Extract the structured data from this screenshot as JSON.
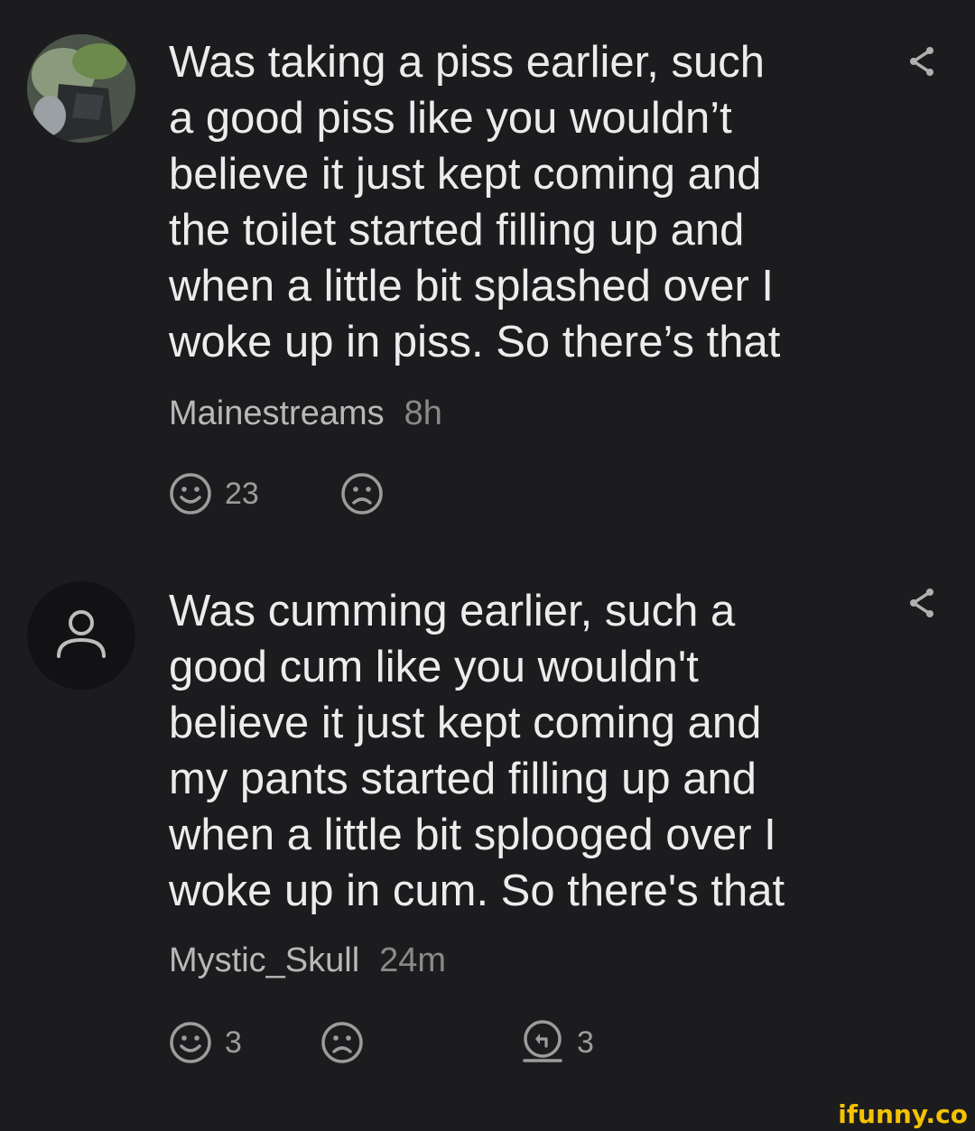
{
  "comments": [
    {
      "text": "Was taking a piss earlier, such\na good piss like you wouldn’t\nbelieve it just kept coming and\nthe toilet started filling up and\nwhen a little bit splashed over I\nwoke up in piss. So there’s that",
      "username": "Mainestreams",
      "time": "8h",
      "smile_count": "23",
      "avatar": "photo",
      "share_icon": "share-icon"
    },
    {
      "text": "Was cumming earlier, such a\ngood cum like you wouldn't\nbelieve it just kept coming and\nmy pants started filling up and\nwhen a little bit splooged over I\nwoke up in cum. So there's that",
      "username": "Mystic_Skull",
      "time": "24m",
      "smile_count": "3",
      "reply_count": "3",
      "avatar": "default-user-icon",
      "share_icon": "share-icon"
    }
  ],
  "watermark": "ifunny.co",
  "colors": {
    "background": "#1c1c1f",
    "text": "#ececec",
    "username": "#b8b8b8",
    "time": "#8a8a8a",
    "icon": "#9c9c9c",
    "watermark": "#f5c200"
  }
}
